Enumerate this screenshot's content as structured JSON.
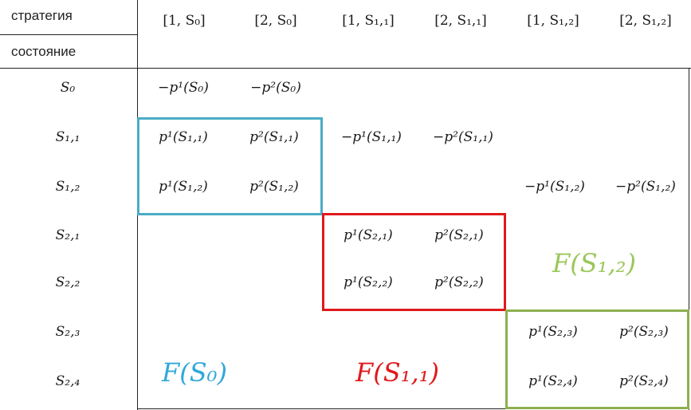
{
  "header": {
    "strategy_label": "стратегия",
    "state_label": "состояние",
    "columns": [
      "[1, S₀]",
      "[2, S₀]",
      "[1, S₁,₁]",
      "[2, S₁,₁]",
      "[1, S₁,₂]",
      "[2, S₁,₂]"
    ]
  },
  "rows": [
    "S₀",
    "S₁,₁",
    "S₁,₂",
    "S₂,₁",
    "S₂,₂",
    "S₂,₃",
    "S₂,₄"
  ],
  "cells": {
    "r0": [
      "−p¹(S₀)",
      "−p²(S₀)"
    ],
    "r1a": [
      "p¹(S₁,₁)",
      "p²(S₁,₁)"
    ],
    "r1b": [
      "−p¹(S₁,₁)",
      "−p²(S₁,₁)"
    ],
    "r2a": [
      "p¹(S₁,₂)",
      "p²(S₁,₂)"
    ],
    "r2b": [
      "−p¹(S₁,₂)",
      "−p²(S₁,₂)"
    ],
    "r3": [
      "p¹(S₂,₁)",
      "p²(S₂,₁)"
    ],
    "r4": [
      "p¹(S₂,₂)",
      "p²(S₂,₂)"
    ],
    "r5": [
      "p¹(S₂,₃)",
      "p²(S₂,₃)"
    ],
    "r6": [
      "p¹(S₂,₄)",
      "p²(S₂,₄)"
    ]
  },
  "block_labels": {
    "f_s0": "F(S₀)",
    "f_s11": "F(S₁,₁)",
    "f_s12": "F(S₁,₂)"
  },
  "colors": {
    "blue": "#4BACC6",
    "red": "#E0191C",
    "green": "#8DB04F",
    "blue_text": "#2FA8DA",
    "green_text": "#9BC75A"
  }
}
